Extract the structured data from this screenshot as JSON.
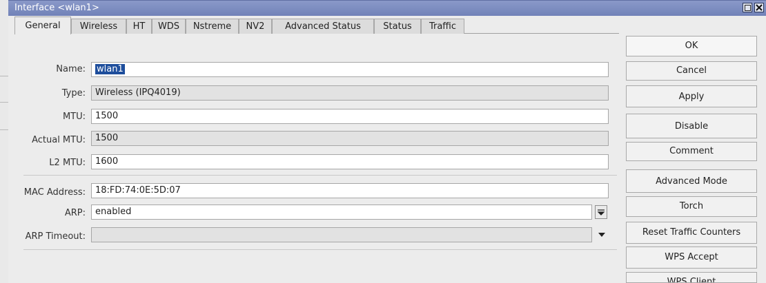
{
  "window": {
    "title": "Interface <wlan1>"
  },
  "tabs": [
    "General",
    "Wireless",
    "HT",
    "WDS",
    "Nstreme",
    "NV2",
    "Advanced Status",
    "Status",
    "Traffic"
  ],
  "form": {
    "name": {
      "label": "Name:",
      "value": "wlan1"
    },
    "type": {
      "label": "Type:",
      "value": "Wireless (IPQ4019)"
    },
    "mtu": {
      "label": "MTU:",
      "value": "1500"
    },
    "actual_mtu": {
      "label": "Actual MTU:",
      "value": "1500"
    },
    "l2_mtu": {
      "label": "L2 MTU:",
      "value": "1600"
    },
    "mac_address": {
      "label": "MAC Address:",
      "value": "18:FD:74:0E:5D:07"
    },
    "arp": {
      "label": "ARP:",
      "value": "enabled"
    },
    "arp_timeout": {
      "label": "ARP Timeout:",
      "value": ""
    }
  },
  "buttons": [
    "OK",
    "Cancel",
    "Apply",
    "Disable",
    "Comment",
    "Advanced Mode",
    "Torch",
    "Reset Traffic Counters",
    "WPS Accept",
    "WPS Client"
  ],
  "colors": {
    "titlebar": "#7f8fc3",
    "selection": "#1e4e9c",
    "window_bg": "#ececec"
  }
}
